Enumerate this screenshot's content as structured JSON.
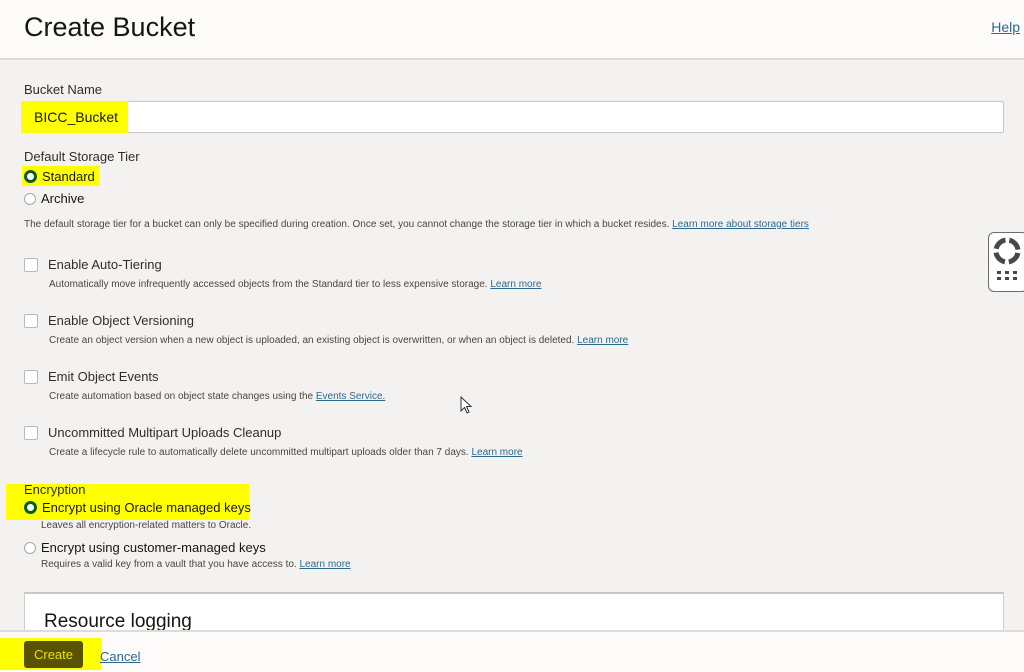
{
  "header": {
    "title": "Create Bucket",
    "help_link": "Help"
  },
  "bucket_name": {
    "label": "Bucket Name",
    "value": "BICC_Bucket"
  },
  "storage_tier": {
    "label": "Default Storage Tier",
    "options": [
      {
        "label": "Standard",
        "selected": true
      },
      {
        "label": "Archive",
        "selected": false
      }
    ],
    "description": "The default storage tier for a bucket can only be specified during creation. Once set, you cannot change the storage tier in which a bucket resides.",
    "link": "Learn more about storage tiers"
  },
  "options": [
    {
      "label": "Enable Auto-Tiering",
      "checked": false,
      "description": "Automatically move infrequently accessed objects from the Standard tier to less expensive storage.",
      "link": "Learn more"
    },
    {
      "label": "Enable Object Versioning",
      "checked": false,
      "description": "Create an object version when a new object is uploaded, an existing object is overwritten, or when an object is deleted.",
      "link": "Learn more"
    },
    {
      "label": "Emit Object Events",
      "checked": false,
      "description": "Create automation based on object state changes using the",
      "link": "Events Service."
    },
    {
      "label": "Uncommitted Multipart Uploads Cleanup",
      "checked": false,
      "description": "Create a lifecycle rule to automatically delete uncommitted multipart uploads older than 7 days.",
      "link": "Learn more"
    }
  ],
  "encryption": {
    "label": "Encryption",
    "options": [
      {
        "label": "Encrypt using Oracle managed keys",
        "selected": true,
        "description": "Leaves all encryption-related matters to Oracle.",
        "link": ""
      },
      {
        "label": "Encrypt using customer-managed keys",
        "selected": false,
        "description": "Requires a valid key from a vault that you have access to.",
        "link": "Learn more"
      }
    ]
  },
  "resource_logging": {
    "title": "Resource logging"
  },
  "footer": {
    "create_label": "Create",
    "cancel_label": "Cancel"
  },
  "colors": {
    "accent_green": "#0b5b19",
    "link": "#2b6a8e",
    "highlight": "#ffff00",
    "create_button": "#595200"
  }
}
